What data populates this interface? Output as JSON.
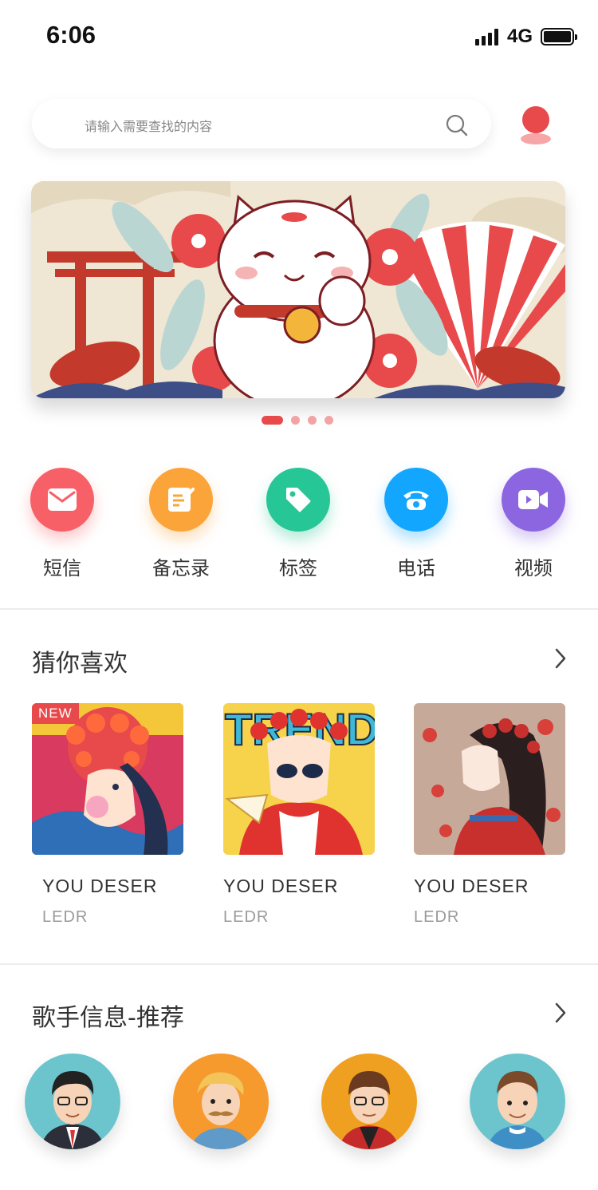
{
  "status_bar": {
    "time": "6:06",
    "network": "4G"
  },
  "search": {
    "placeholder": "请输入需要查找的内容"
  },
  "quick_menu": [
    {
      "label": "短信",
      "icon": "mail-icon",
      "color": "#f86068"
    },
    {
      "label": "备忘录",
      "icon": "note-icon",
      "color": "#fba43a"
    },
    {
      "label": "标签",
      "icon": "tag-icon",
      "color": "#27c696"
    },
    {
      "label": "电话",
      "icon": "phone-icon",
      "color": "#13a6ff"
    },
    {
      "label": "视频",
      "icon": "video-icon",
      "color": "#8c66e0"
    }
  ],
  "guess_section": {
    "title": "猜你喜欢",
    "cards": [
      {
        "badge": "NEW",
        "title": "YOU DESER",
        "subtitle": "LEDR"
      },
      {
        "title": "YOU DESER",
        "subtitle": "LEDR",
        "art_text": "TREND"
      },
      {
        "title": "YOU DESER",
        "subtitle": "LEDR"
      }
    ]
  },
  "singer_section": {
    "title": "歌手信息-推荐"
  },
  "carousel": {
    "count": 4,
    "active": 0
  },
  "colors": {
    "accent": "#e8494b"
  }
}
